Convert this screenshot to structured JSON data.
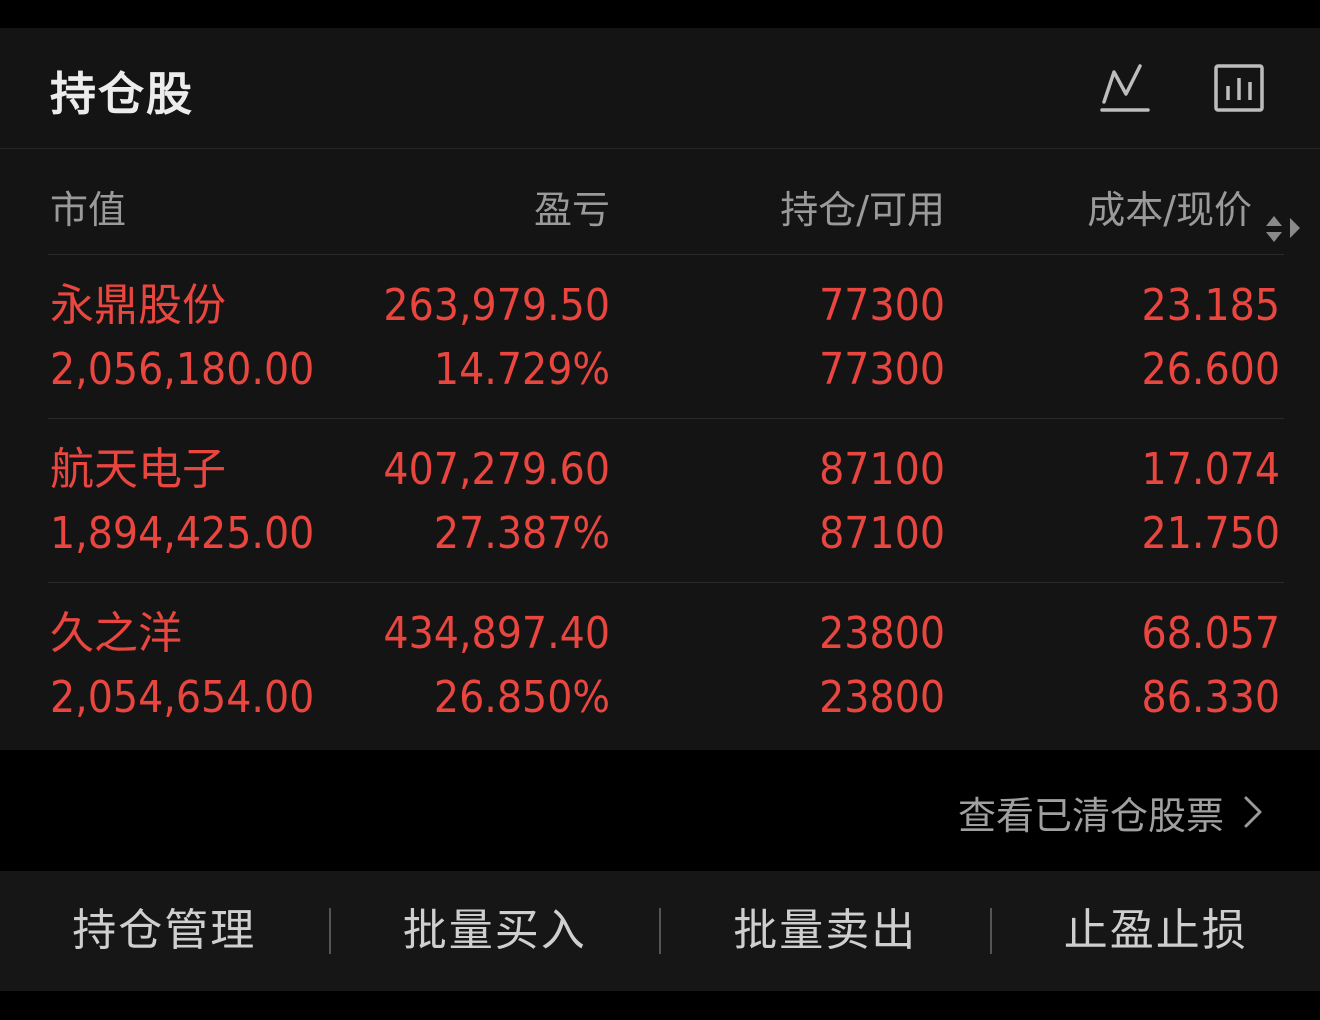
{
  "header": {
    "title": "持仓股"
  },
  "columns": {
    "market_value": "市值",
    "profit_loss": "盈亏",
    "position_available": "持仓/可用",
    "cost_price": "成本/现价"
  },
  "positions": [
    {
      "name": "永鼎股份",
      "market_value": "2,056,180.00",
      "profit_loss": "263,979.50",
      "profit_loss_pct": "14.729%",
      "position": "77300",
      "available": "77300",
      "cost": "23.185",
      "price": "26.600"
    },
    {
      "name": "航天电子",
      "market_value": "1,894,425.00",
      "profit_loss": "407,279.60",
      "profit_loss_pct": "27.387%",
      "position": "87100",
      "available": "87100",
      "cost": "17.074",
      "price": "21.750"
    },
    {
      "name": "久之洋",
      "market_value": "2,054,654.00",
      "profit_loss": "434,897.40",
      "profit_loss_pct": "26.850%",
      "position": "23800",
      "available": "23800",
      "cost": "68.057",
      "price": "86.330"
    }
  ],
  "closed_link": {
    "label": "查看已清仓股票"
  },
  "actions": {
    "manage": "持仓管理",
    "batch_buy": "批量买入",
    "batch_sell": "批量卖出",
    "stop": "止盈止损"
  },
  "colors": {
    "gain": "#e8463f",
    "text_muted": "#9a9a9a",
    "panel_bg": "#141414"
  },
  "icons": {
    "trend": "trend-line-icon",
    "bars": "bar-chart-icon",
    "sort": "sort-icon",
    "chevron": "chevron-right-icon"
  }
}
